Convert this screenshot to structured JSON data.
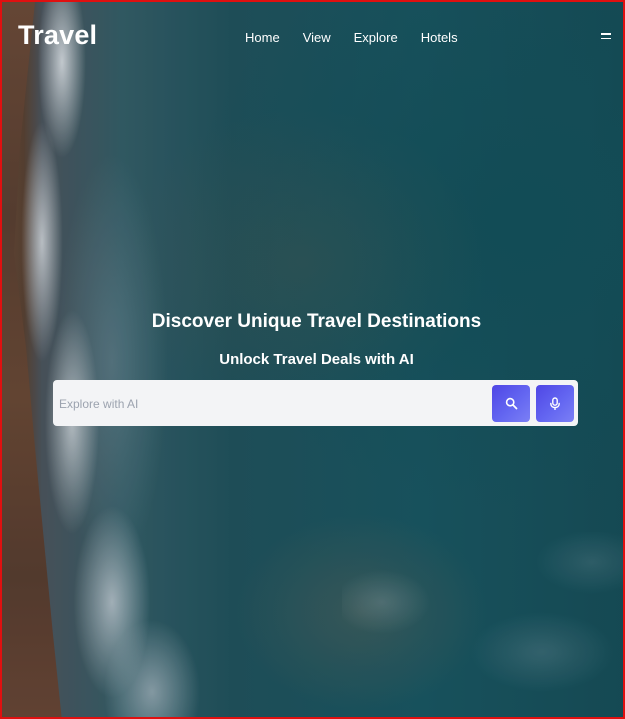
{
  "header": {
    "logo": "Travel",
    "nav": [
      "Home",
      "View",
      "Explore",
      "Hotels"
    ],
    "menu_icon": "hamburger-icon"
  },
  "hero": {
    "title": "Discover Unique Travel Destinations",
    "subtitle": "Unlock Travel Deals with AI"
  },
  "search": {
    "placeholder": "Explore with AI",
    "value": "",
    "search_icon": "search-icon",
    "voice_icon": "microphone-icon"
  },
  "colors": {
    "accent": "#5b5ff0",
    "text": "#ffffff",
    "border": "#e01010"
  }
}
